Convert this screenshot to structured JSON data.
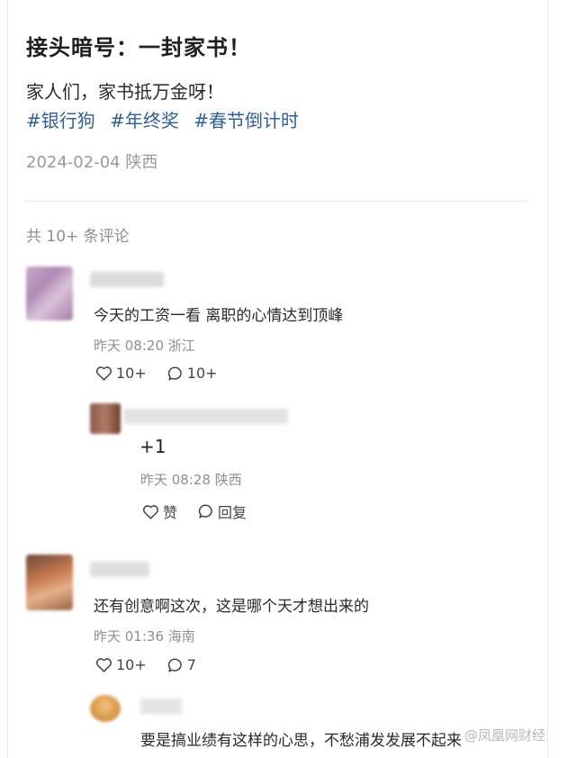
{
  "post": {
    "title": "接头暗号：一封家书！",
    "body": "家人们，家书抵万金呀！",
    "tags": [
      "#银行狗",
      "#年终奖",
      "#春节倒计时"
    ],
    "date": "2024-02-04",
    "location": "陕西"
  },
  "comments_header": "共 10+ 条评论",
  "comments": [
    {
      "text": "今天的工资一看 离职的心情达到顶峰",
      "time": "昨天 08:20",
      "location": "浙江",
      "likes": "10+",
      "replies": "10+",
      "sub_reply": {
        "text": "+1",
        "time": "昨天 08:28",
        "location": "陕西",
        "like_label": "赞",
        "reply_label": "回复"
      }
    },
    {
      "text": "还有创意啊这次，这是哪个天才想出来的",
      "time": "昨天 01:36",
      "location": "海南",
      "likes": "10+",
      "replies": "7",
      "sub_reply": {
        "text": "要是搞业绩有这样的心思，不愁浦发发展不起来"
      }
    }
  ],
  "watermark": "@凤凰网财经",
  "colors": {
    "tag": "#2f5f94",
    "meta": "#9a9a9a",
    "text": "#2a2a2a"
  },
  "icons": [
    "heart-icon",
    "comment-icon"
  ]
}
